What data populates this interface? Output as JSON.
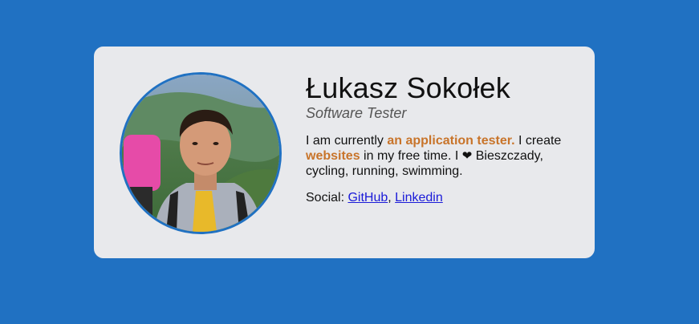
{
  "profile": {
    "name": "Łukasz Sokołek",
    "role": "Software Tester",
    "bio": {
      "part1": "I am currently ",
      "highlight1": "an application tester.",
      "part2": " I create ",
      "highlight2": "websites",
      "part3": " in my free time. I ",
      "heart": "❤",
      "part4": " Bieszczady, cycling, running, swimming."
    },
    "social": {
      "label": "Social: ",
      "links": [
        {
          "label": "GitHub"
        },
        {
          "label": "Linkedin"
        }
      ],
      "separator": ", "
    }
  },
  "colors": {
    "background": "#2071c2",
    "card": "#e8e9ec",
    "highlight": "#c8742a",
    "link": "#1a1ad8"
  }
}
